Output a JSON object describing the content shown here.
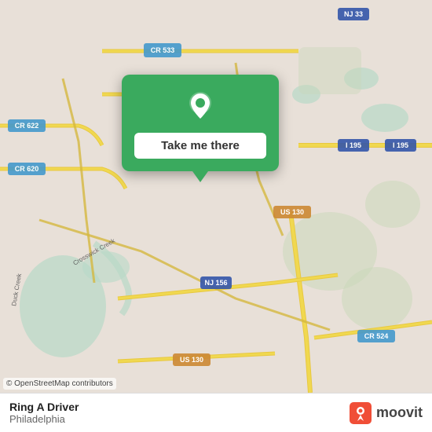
{
  "map": {
    "attribution": "© OpenStreetMap contributors",
    "background_color": "#e8e0d8"
  },
  "popup": {
    "button_label": "Take me there",
    "pin_color": "#ffffff"
  },
  "bottom_bar": {
    "app_name": "Ring A Driver",
    "city": "Philadelphia",
    "logo_text": "moovit"
  }
}
